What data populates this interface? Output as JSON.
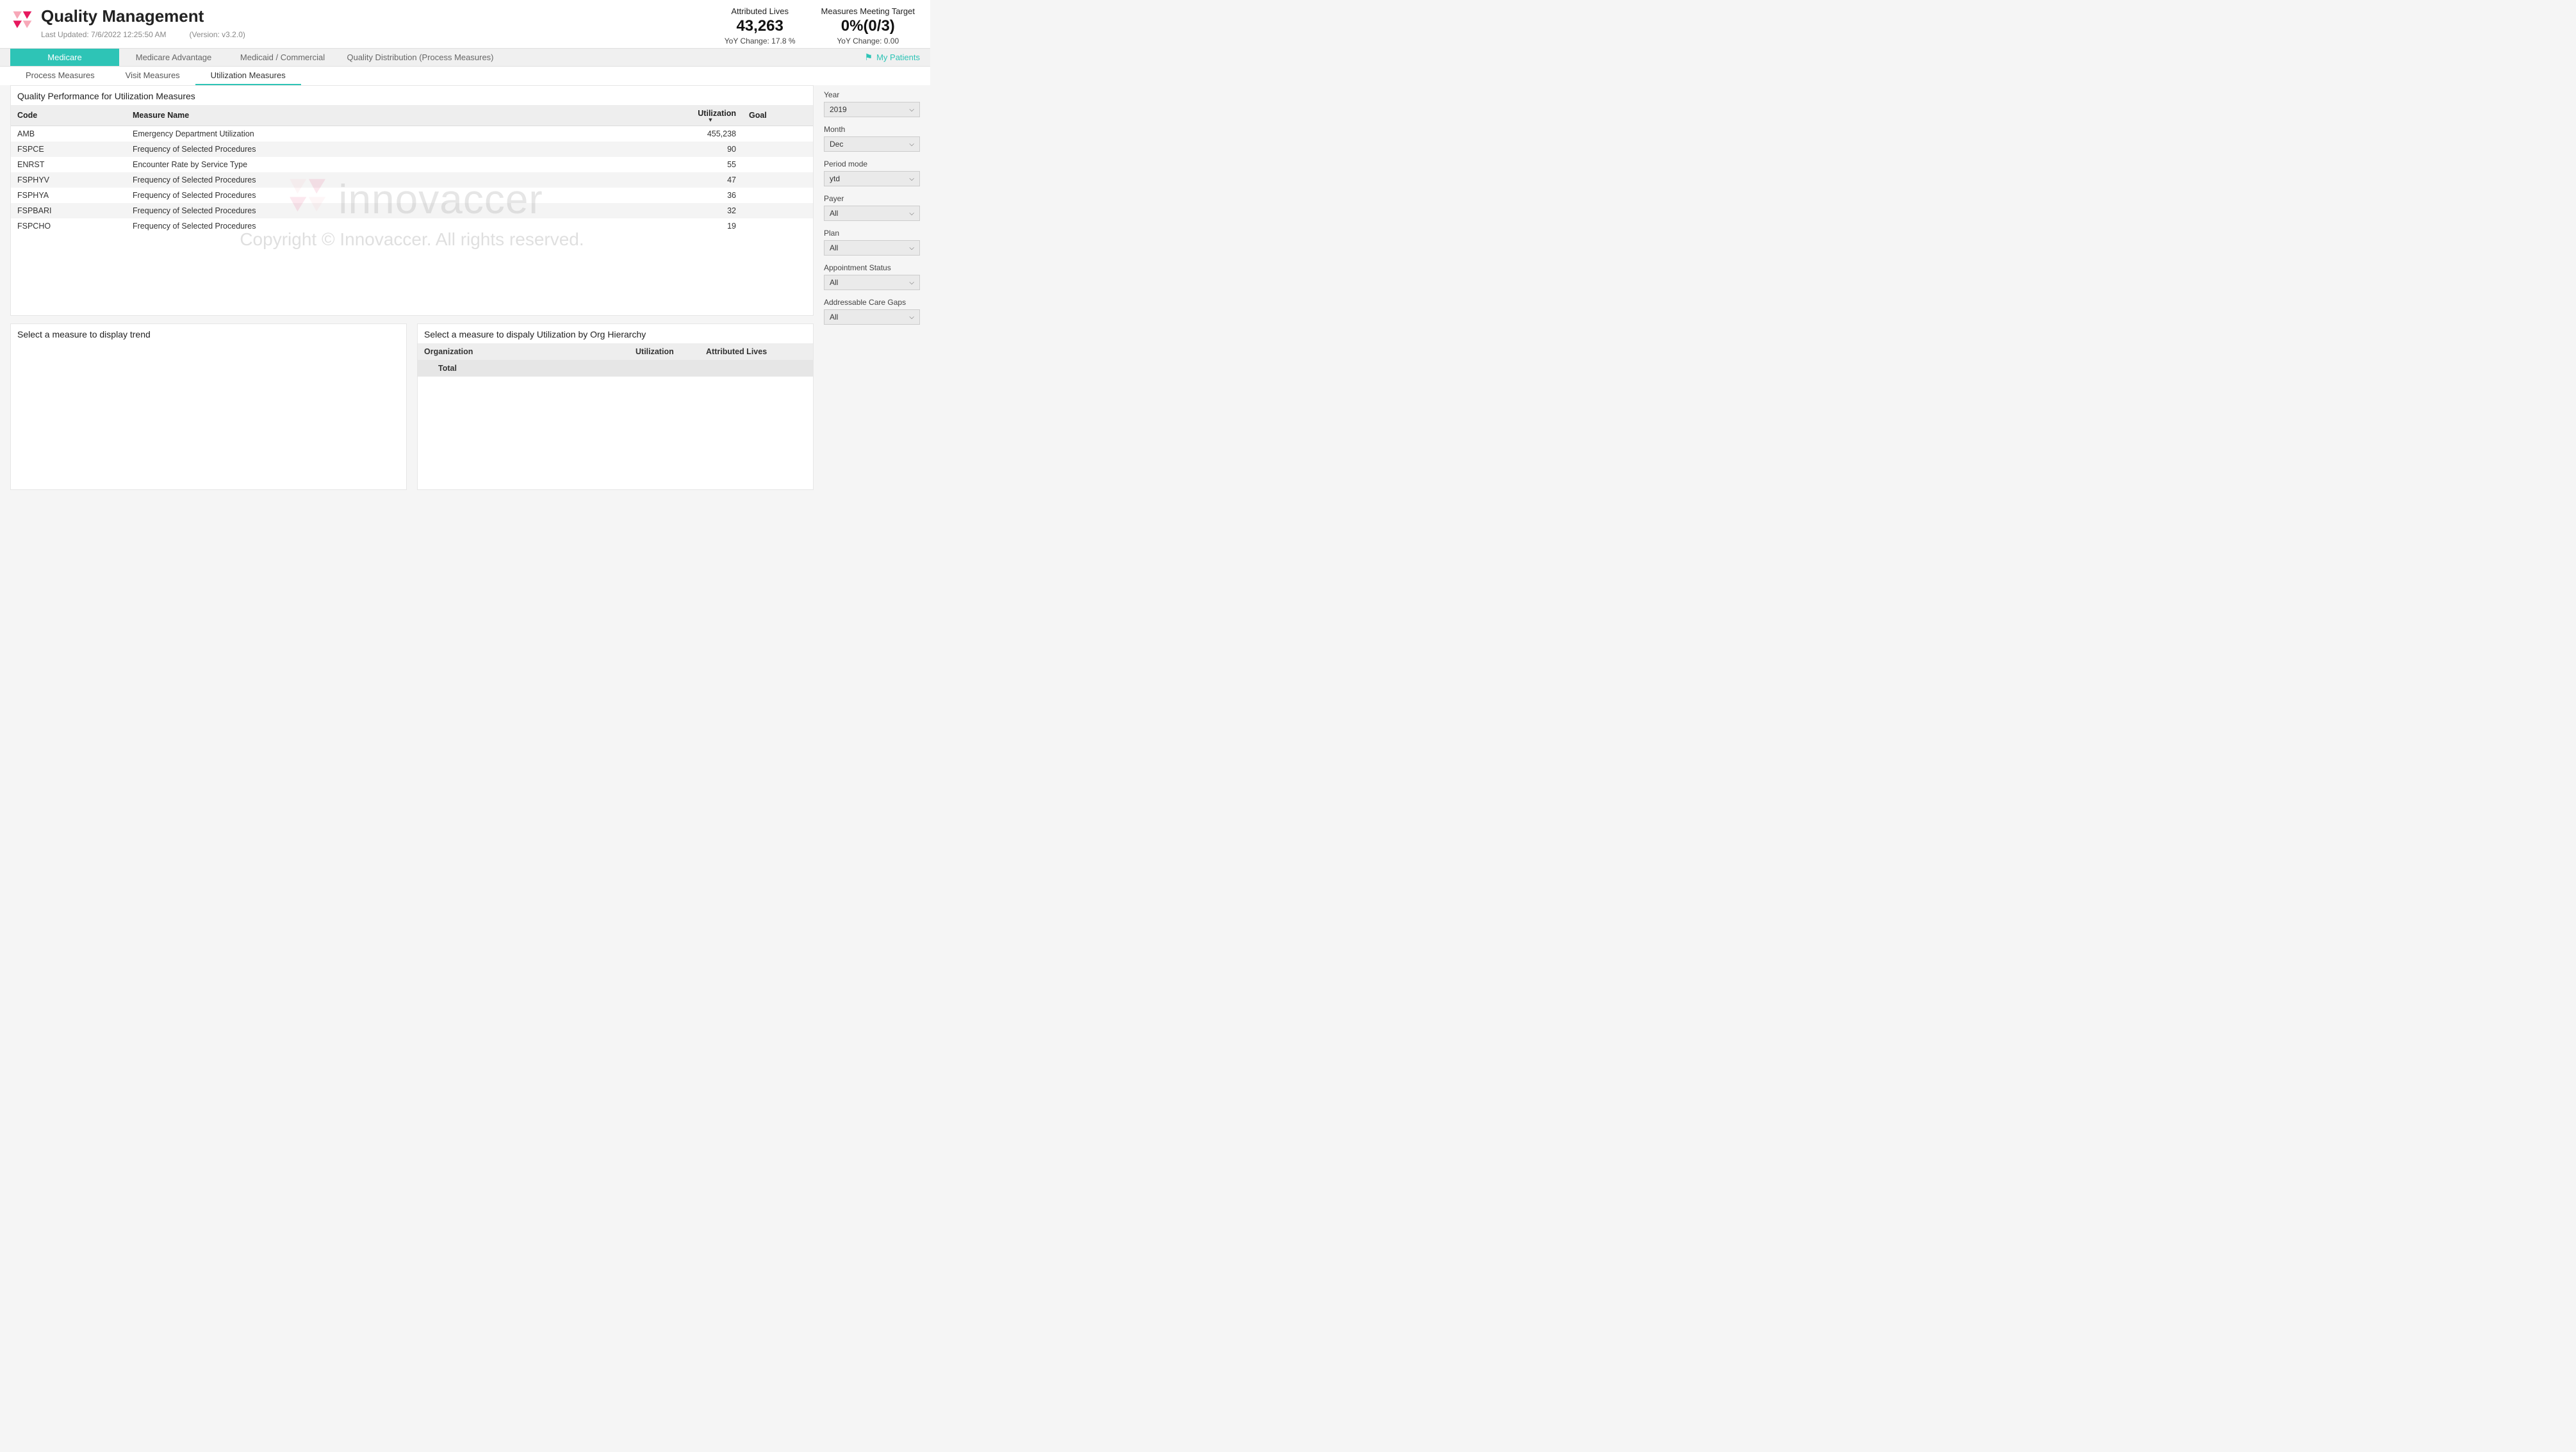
{
  "header": {
    "title": "Quality Management",
    "last_updated_label": "Last Updated: 7/6/2022 12:25:50 AM",
    "version_label": "(Version: v3.2.0)"
  },
  "stats": {
    "attributed": {
      "label": "Attributed Lives",
      "value": "43,263",
      "sub": "YoY Change: 17.8 %"
    },
    "measures": {
      "label": "Measures Meeting Target",
      "value": "0%(0/3)",
      "sub": "YoY Change: 0.00"
    }
  },
  "primary_tabs": {
    "medicare": "Medicare",
    "medicare_adv": "Medicare Advantage",
    "medicaid": "Medicaid / Commercial",
    "quality_dist": "Quality Distribution (Process Measures)",
    "my_patients": "My Patients"
  },
  "secondary_tabs": {
    "process": "Process Measures",
    "visit": "Visit Measures",
    "utilization": "Utilization Measures"
  },
  "main_table": {
    "title": "Quality Performance for Utilization Measures",
    "headers": {
      "code": "Code",
      "name": "Measure Name",
      "util": "Utilization",
      "goal": "Goal"
    },
    "rows": [
      {
        "code": "AMB",
        "name": "Emergency Department Utilization",
        "util": "455,238",
        "goal": ""
      },
      {
        "code": "FSPCE",
        "name": "Frequency of Selected Procedures",
        "util": "90",
        "goal": ""
      },
      {
        "code": "ENRST",
        "name": "Encounter Rate by Service Type",
        "util": "55",
        "goal": ""
      },
      {
        "code": "FSPHYV",
        "name": "Frequency of Selected Procedures",
        "util": "47",
        "goal": ""
      },
      {
        "code": "FSPHYA",
        "name": "Frequency of Selected Procedures",
        "util": "36",
        "goal": ""
      },
      {
        "code": "FSPBARI",
        "name": "Frequency of Selected Procedures",
        "util": "32",
        "goal": ""
      },
      {
        "code": "FSPCHO",
        "name": "Frequency of Selected Procedures",
        "util": "19",
        "goal": ""
      }
    ]
  },
  "trend_panel": {
    "title": "Select a measure to display trend"
  },
  "org_panel": {
    "title": "Select a measure to dispaly Utilization by Org Hierarchy",
    "headers": {
      "org": "Organization",
      "util": "Utilization",
      "lives": "Attributed Lives"
    },
    "total_label": "Total"
  },
  "filters": {
    "year": {
      "label": "Year",
      "value": "2019"
    },
    "month": {
      "label": "Month",
      "value": "Dec"
    },
    "period": {
      "label": "Period mode",
      "value": "ytd"
    },
    "payer": {
      "label": "Payer",
      "value": "All"
    },
    "plan": {
      "label": "Plan",
      "value": "All"
    },
    "appt": {
      "label": "Appointment Status",
      "value": "All"
    },
    "gaps": {
      "label": "Addressable Care Gaps",
      "value": "All"
    }
  },
  "watermark": {
    "name": "innovaccer",
    "copy": "Copyright © Innovaccer. All rights reserved."
  }
}
